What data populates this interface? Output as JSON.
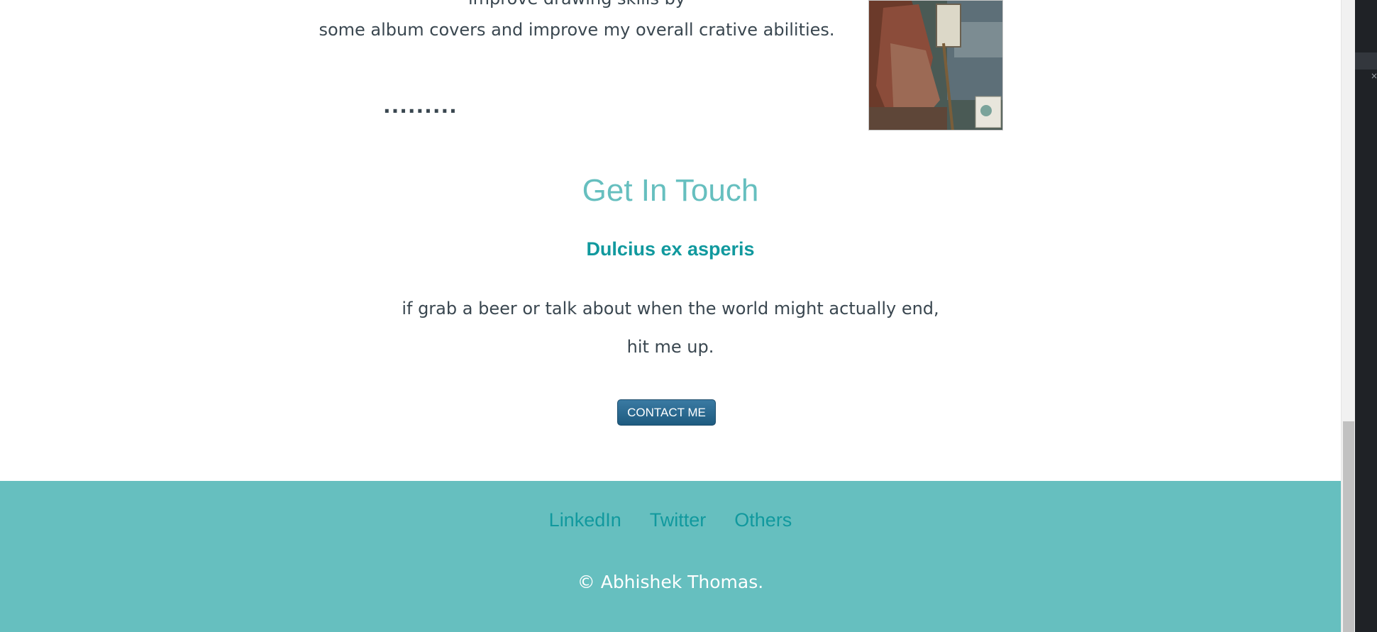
{
  "about": {
    "line_top_partial": "improve drawing skills by",
    "line_bottom": "some album covers and improve my overall crative abilities.",
    "dots": "........."
  },
  "contact": {
    "title": "Get In Touch",
    "subtitle": "Dulcius ex asperis",
    "line1": "if grab a beer or talk about when the world might actually end,",
    "line2": "hit me up.",
    "button_label": "CONTACT ME"
  },
  "footer": {
    "links": [
      "LinkedIn",
      "Twitter",
      "Others"
    ],
    "copyright": "© Abhishek Thomas."
  },
  "side_panel": {
    "close_glyph": "×"
  },
  "colors": {
    "accent": "#66bfbf",
    "accent_dark": "#11999e",
    "text": "#3a4750",
    "button": "#1e5b80"
  }
}
